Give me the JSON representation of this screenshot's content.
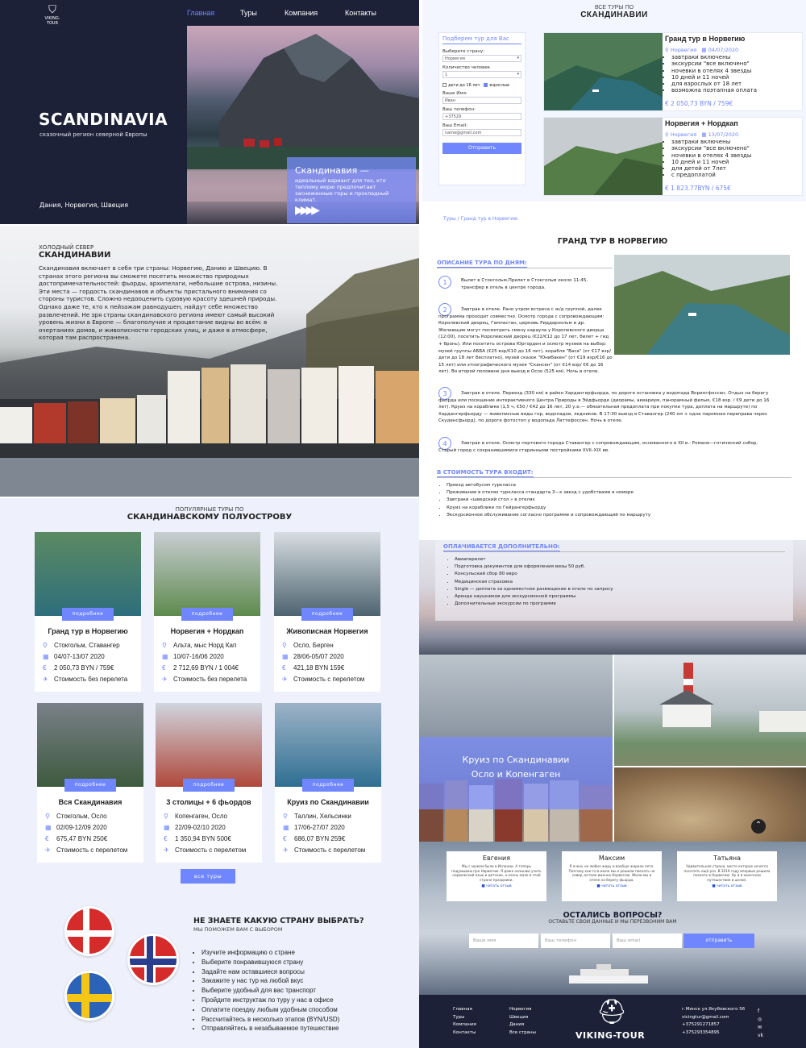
{
  "nav": {
    "logo_text": "VIKING-TOUR",
    "items": [
      "Главная",
      "Туры",
      "Компания",
      "Контакты"
    ]
  },
  "hero": {
    "title": "SCANDINAVIA",
    "subtitle": "сказочный регион северной Европы",
    "countries": "Дания, Норвегия, Швеция",
    "promo_title": "Скандинавия —",
    "promo_text": "идеальный вариант для тех, кто теплому морю предпочитает заснеженные горы и прохладный климат."
  },
  "tours_top": {
    "small": "ВСЕ ТУРЫ ПО",
    "big": "СКАНДИНАВИИ"
  },
  "form": {
    "title": "Подберем тур для Вас",
    "country_label": "Выберите страну:",
    "country_value": "Норвегия",
    "people_label": "Количество человек",
    "people_value": "1",
    "kids_label": "дети до 16 лет",
    "adults_label": "взрослые",
    "name_label": "Ваше Имя:",
    "name_value": "Иван",
    "phone_label": "Ваш телефон:",
    "phone_value": "+37529",
    "email_label": "Ваш Email:",
    "email_value": "name@gmail.com",
    "submit": "Отправить"
  },
  "featured": [
    {
      "title": "Гранд тур в Норвегию",
      "country": "Норвегия",
      "date": "04/07/2020",
      "features": [
        "завтраки включены",
        "экскурсии \"все включено\"",
        "ночевки в отелях 4 звезды",
        "10 дней и 11 ночей",
        "для взрослых от 18 лет",
        "возможна поэтапная оплата"
      ],
      "price": "€ 2 050,73 BYN / 759€"
    },
    {
      "title": "Норвегия + Нордкап",
      "country": "Норвегия",
      "date": "13/07/2020",
      "features": [
        "завтраки включены",
        "экскурсии \"все включено\"",
        "ночевки в отелях 4 звезды",
        "10 дней и 11 ночей",
        "для детей от 7лет",
        "с предоплатой"
      ],
      "price": "€ 1 823.77BYN / 675€"
    }
  ],
  "north": {
    "small": "ХОЛОДНЫЙ СЕВЕР",
    "big": "СКАНДИНАВИИ",
    "text": "Скандинавия включает в себя три страны: Норвегию, Данию и Швецию. В странах этого региона вы сможете посетить множество природных достопримечательностей: фьорды, архипелаги, небольшие острова, низины. Эти места — гордость скандинавов и объекты пристального внимания со стороны туристов. Сложно недооценить суровую красоту здешней природы. Однако даже те, кто к пейзажам равнодушен, найдут себе множество развлечений. Не зря страны скандинавского региона имеют самый высокий уровень жизни в Европе — благополучие и процветание видны во всём: в очертаниях домов, и живописности городских улиц, и даже в атмосфере, которая там распространена."
  },
  "popular": {
    "small": "ПОПУЛЯРНЫЕ ТУРЫ ПО",
    "big": "СКАНДИНАВСКОМУ ПОЛУОСТРОВУ",
    "more_label": "подробнее",
    "all_tours": "все туры",
    "cards": [
      {
        "name": "Гранд тур в Норвегию",
        "place": "Стокгольм, Ставангер",
        "dates": "04/07-13/07 2020",
        "price": "2 050,73 BYN / 759€",
        "flight": "Стоимость без перелета"
      },
      {
        "name": "Норвегия + Нордкап",
        "place": "Альта, мыс Норд Кап",
        "dates": "10/07-16/06 2020",
        "price": "2 712,69 BYN / 1 004€",
        "flight": "Стоимость без перелета"
      },
      {
        "name": "Живописная Норвегия",
        "place": "Осло, Берген",
        "dates": "28/06-05/07 2020",
        "price": "421,18 BYN 159€",
        "flight": "Стоимость с перелетом"
      },
      {
        "name": "Вся Скандинавия",
        "place": "Стокгольм, Осло",
        "dates": "02/09-12/09 2020",
        "price": "675,47 BYN 250€",
        "flight": "Стоимость с перелетом"
      },
      {
        "name": "3 столицы + 6 фьордов",
        "place": "Копенгаген, Осло",
        "dates": "22/09-02/10 2020",
        "price": "1 350,94 BYN 500€",
        "flight": "Стоимость с перелетом"
      },
      {
        "name": "Круиз по Скандинавии",
        "place": "Таллин, Хельсинки",
        "dates": "17/06-27/07 2020",
        "price": "686,07 BYN 259€",
        "flight": "Стоимость с перелетом"
      }
    ]
  },
  "help": {
    "title": "НЕ ЗНАЕТЕ КАКУЮ СТРАНУ ВЫБРАТЬ?",
    "subtitle": "МЫ ПОМОЖЕМ ВАМ С ВЫБОРОМ",
    "steps": [
      "Изучите информацию о стране",
      "Выберите понравившуюся страну",
      "Задайте нам оставшиеся вопросы",
      "Закажите у нас тур на любой вкус",
      "Выберите удобный для вас транспорт",
      "Пройдите инструктаж по туру у нас в офисе",
      "Оплатите поездку любым удобным способом",
      "Рассчитайтесь в несколько этапов (BYN/USD)",
      "Отправляйтесь в незабываемое путешествие"
    ]
  },
  "detail": {
    "breadcrumb": "Туры / Гранд тур в Норвегию",
    "title": "ГРАНД ТУР В НОРВЕГИЮ",
    "program_label": "ОПИСАНИЕ ТУРА ПО ДНЯМ:",
    "days": [
      {
        "n": "1",
        "text": "Вылет в Стокгольм.Прилет в Стокгольм около 11:45, трансфер в отель в центре города."
      },
      {
        "n": "2",
        "text": "Завтрак в отеле. Рано утром встреча с ж/д группой, далее программа проходит совместно. Осмотр города с сопровождающим: Королевский дворец, Гамластан, церковь Риддархольм и др. Желающие могут посмотреть смену караула у Королевского дворца (12:00), посетить Королевский дворец (€22/€12 до 17 лет, билет + гид + бронь). Или посетить острова Юргорден и осмотр музеев на выбор: музей группы АББА (€25 взр/€10 до 16 лет), корабля \"Васа\" (от €17 взр/дети до 18 лет бесплатно), музей сказок \"Юнибакен\" (от €19 взр/€16 до 15 лет) или этнографического музея \"Скансен\" (от €14 взр/ €6 до 16 лет). Во второй половине дня выезд в Осло (525 км). Ночь в отеле."
      },
      {
        "n": "3",
        "text": "Завтрак в отеле. Переезд (330 км) в район Хардангерфьорда, по дороге остановка у водопада Ворингфоссен. Отдых на берегу фьорда или посещение интерактивного Центра Природы в Эйдфьорде (диорамы, аквариум, панорамный фильм, €18 взр. / €9 дети до 16 лет). Круиз на кораблике (1,5 ч, €50 / €42 до 16 лет, 20 у.е.— обязательная предоплата при покупке тура, доплата на маршруте) по Хардангерфьорду — живописные виды гор, водопадов, ледников. В 17:30 выезд в Ставангер (240 км + одна паромная переправа через Скуденсфьорд), по дороге фотостоп у водопада Латтефоссен. Ночь в отеле."
      },
      {
        "n": "4",
        "text": "Завтрак в отеле. Осмотр портового города Ставангер с сопровождающим, основанного в XII в.: Романо—готический собор, Старый город с сохранившимися старинными постройками XVII–XIX вв."
      }
    ],
    "included_label": "В СТОИМОСТЬ ТУРА ВХОДИТ:",
    "included": [
      "Проезд автобусом туркласса",
      "Проживание в отелях туркласса стандарта 3—х звезд с удобствами в номере",
      "Завтраки «шведский стол » в отелях",
      "Круиз на кораблике по Гейрангерфьорду",
      "Экскурсионное обслуживание согласно программе и сопровождающий по маршруту"
    ],
    "paid_label": "ОПЛАЧИВАЕТСЯ ДОПОЛНИТЕЛЬНО:",
    "paid": [
      "Авиаперелет",
      "Подготовка документов для оформления визы 50 руб.",
      "Консульский сбор 80 евро",
      "Медицинская страховка",
      "Single — доплата за одноместное размещение в отеле по запросу",
      "Аренда наушников для экскурсионной программы",
      "Дополнительные экскурсии по программе"
    ]
  },
  "cruise": {
    "line1": "Круиз по Скандинавии",
    "line2": "Осло и Копенгаген"
  },
  "reviews": [
    {
      "name": "Евгения",
      "text": "Мы с мужем были в Испании. А теперь подумываю про Норвегию. Я даже начинаю учить норвежский язык и детские, а очень мало в этой стране праздники.",
      "link": "читать отзыв"
    },
    {
      "name": "Максим",
      "text": "Я очень не любил жару и вообще жаркое лето. Поэтому как-то в июле мы и решили поехать на север, встали именно Норвегию. Жили мы в отеле на берегу фьорда.",
      "link": "читать отзыв"
    },
    {
      "name": "Татьяна",
      "text": "Удивительная страна, место которое хочется посетить ещё раз. В 2019 году впервые решила поехать в Норвегию. Ну и в конечном путешествие в целом.",
      "link": "читать отзыв"
    }
  ],
  "contact": {
    "title": "ОСТАЛИСЬ ВОПРОСЫ?",
    "subtitle": "ОСТАВЬТЕ СВОИ ДАННЫЕ И МЫ ПЕРЕЗВОНИМ ВАМ",
    "name_ph": "Ваше имя",
    "phone_ph": "Ваш телефон",
    "email_ph": "Ваш email",
    "submit": "отправить"
  },
  "footer": {
    "col1": [
      "Главная",
      "Туры",
      "Компания",
      "Контакты"
    ],
    "col2": [
      "Норвегия",
      "Швеция",
      "Дания",
      "Все страны"
    ],
    "brand": "VIKING-TOUR",
    "address": [
      "г.Минск ул.Якубовского 56",
      "vicingtur@gmail.com",
      "+375291271857",
      "+375293354895"
    ]
  },
  "colors": {
    "accent": "#6f86ff",
    "dark": "#1c2138"
  }
}
